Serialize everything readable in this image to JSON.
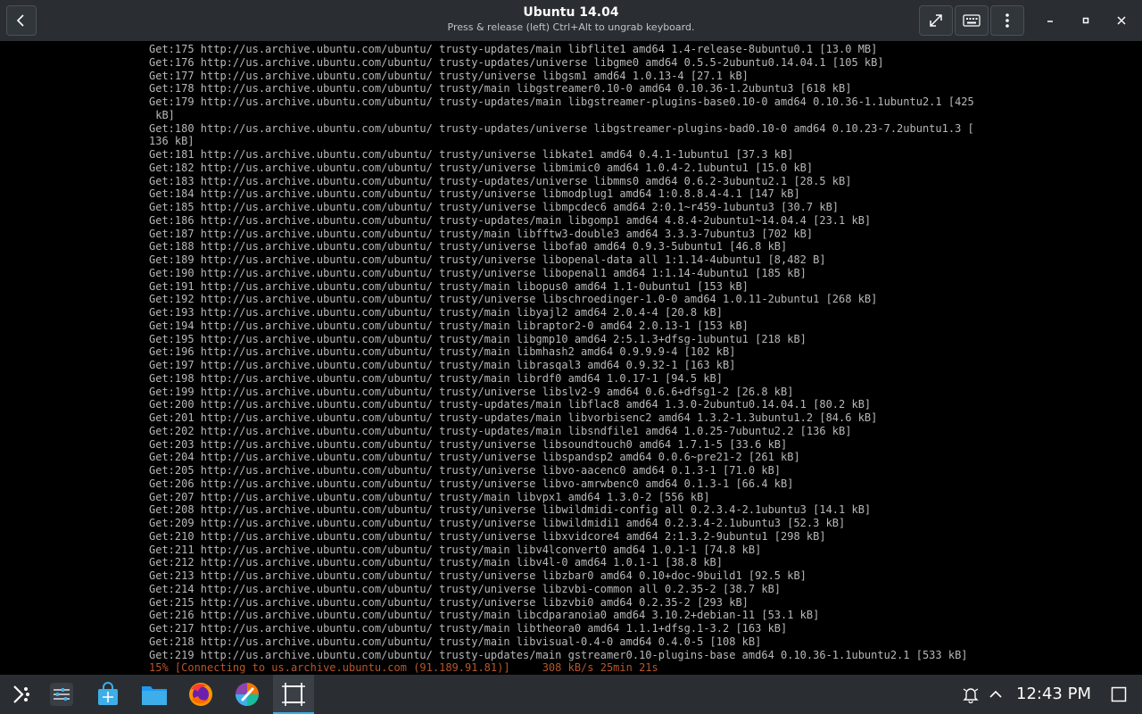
{
  "header": {
    "title": "Ubuntu 14.04",
    "subtitle": "Press & release (left) Ctrl+Alt to ungrab keyboard."
  },
  "icons": {
    "back": "chevron-left-icon",
    "fullscreen": "expand-arrows-icon",
    "keyboard": "keyboard-icon",
    "menu": "kebab-menu-icon",
    "minimize": "minimize-icon",
    "maximize": "maximize-icon",
    "close": "close-icon"
  },
  "terminal": {
    "lines": [
      "Get:175 http://us.archive.ubuntu.com/ubuntu/ trusty-updates/main libflite1 amd64 1.4-release-8ubuntu0.1 [13.0 MB]",
      "Get:176 http://us.archive.ubuntu.com/ubuntu/ trusty-updates/universe libgme0 amd64 0.5.5-2ubuntu0.14.04.1 [105 kB]",
      "Get:177 http://us.archive.ubuntu.com/ubuntu/ trusty/universe libgsm1 amd64 1.0.13-4 [27.1 kB]",
      "Get:178 http://us.archive.ubuntu.com/ubuntu/ trusty/main libgstreamer0.10-0 amd64 0.10.36-1.2ubuntu3 [618 kB]",
      "Get:179 http://us.archive.ubuntu.com/ubuntu/ trusty-updates/main libgstreamer-plugins-base0.10-0 amd64 0.10.36-1.1ubuntu2.1 [425",
      " kB]",
      "Get:180 http://us.archive.ubuntu.com/ubuntu/ trusty-updates/universe libgstreamer-plugins-bad0.10-0 amd64 0.10.23-7.2ubuntu1.3 [",
      "136 kB]",
      "Get:181 http://us.archive.ubuntu.com/ubuntu/ trusty/universe libkate1 amd64 0.4.1-1ubuntu1 [37.3 kB]",
      "Get:182 http://us.archive.ubuntu.com/ubuntu/ trusty/universe libmimic0 amd64 1.0.4-2.1ubuntu1 [15.0 kB]",
      "Get:183 http://us.archive.ubuntu.com/ubuntu/ trusty-updates/universe libmms0 amd64 0.6.2-3ubuntu2.1 [28.5 kB]",
      "Get:184 http://us.archive.ubuntu.com/ubuntu/ trusty/universe libmodplug1 amd64 1:0.8.8.4-4.1 [147 kB]",
      "Get:185 http://us.archive.ubuntu.com/ubuntu/ trusty/universe libmpcdec6 amd64 2:0.1~r459-1ubuntu3 [30.7 kB]",
      "Get:186 http://us.archive.ubuntu.com/ubuntu/ trusty-updates/main libgomp1 amd64 4.8.4-2ubuntu1~14.04.4 [23.1 kB]",
      "Get:187 http://us.archive.ubuntu.com/ubuntu/ trusty/main libfftw3-double3 amd64 3.3.3-7ubuntu3 [702 kB]",
      "Get:188 http://us.archive.ubuntu.com/ubuntu/ trusty/universe libofa0 amd64 0.9.3-5ubuntu1 [46.8 kB]",
      "Get:189 http://us.archive.ubuntu.com/ubuntu/ trusty/universe libopenal-data all 1:1.14-4ubuntu1 [8,482 B]",
      "Get:190 http://us.archive.ubuntu.com/ubuntu/ trusty/universe libopenal1 amd64 1:1.14-4ubuntu1 [185 kB]",
      "Get:191 http://us.archive.ubuntu.com/ubuntu/ trusty/main libopus0 amd64 1.1-0ubuntu1 [153 kB]",
      "Get:192 http://us.archive.ubuntu.com/ubuntu/ trusty/universe libschroedinger-1.0-0 amd64 1.0.11-2ubuntu1 [268 kB]",
      "Get:193 http://us.archive.ubuntu.com/ubuntu/ trusty/main libyajl2 amd64 2.0.4-4 [20.8 kB]",
      "Get:194 http://us.archive.ubuntu.com/ubuntu/ trusty/main libraptor2-0 amd64 2.0.13-1 [153 kB]",
      "Get:195 http://us.archive.ubuntu.com/ubuntu/ trusty/main libgmp10 amd64 2:5.1.3+dfsg-1ubuntu1 [218 kB]",
      "Get:196 http://us.archive.ubuntu.com/ubuntu/ trusty/main libmhash2 amd64 0.9.9.9-4 [102 kB]",
      "Get:197 http://us.archive.ubuntu.com/ubuntu/ trusty/main librasqal3 amd64 0.9.32-1 [163 kB]",
      "Get:198 http://us.archive.ubuntu.com/ubuntu/ trusty/main librdf0 amd64 1.0.17-1 [94.5 kB]",
      "Get:199 http://us.archive.ubuntu.com/ubuntu/ trusty/universe libslv2-9 amd64 0.6.6+dfsg1-2 [26.8 kB]",
      "Get:200 http://us.archive.ubuntu.com/ubuntu/ trusty-updates/main libflac8 amd64 1.3.0-2ubuntu0.14.04.1 [80.2 kB]",
      "Get:201 http://us.archive.ubuntu.com/ubuntu/ trusty-updates/main libvorbisenc2 amd64 1.3.2-1.3ubuntu1.2 [84.6 kB]",
      "Get:202 http://us.archive.ubuntu.com/ubuntu/ trusty-updates/main libsndfile1 amd64 1.0.25-7ubuntu2.2 [136 kB]",
      "Get:203 http://us.archive.ubuntu.com/ubuntu/ trusty/universe libsoundtouch0 amd64 1.7.1-5 [33.6 kB]",
      "Get:204 http://us.archive.ubuntu.com/ubuntu/ trusty/universe libspandsp2 amd64 0.0.6~pre21-2 [261 kB]",
      "Get:205 http://us.archive.ubuntu.com/ubuntu/ trusty/universe libvo-aacenc0 amd64 0.1.3-1 [71.0 kB]",
      "Get:206 http://us.archive.ubuntu.com/ubuntu/ trusty/universe libvo-amrwbenc0 amd64 0.1.3-1 [66.4 kB]",
      "Get:207 http://us.archive.ubuntu.com/ubuntu/ trusty/main libvpx1 amd64 1.3.0-2 [556 kB]",
      "Get:208 http://us.archive.ubuntu.com/ubuntu/ trusty/universe libwildmidi-config all 0.2.3.4-2.1ubuntu3 [14.1 kB]",
      "Get:209 http://us.archive.ubuntu.com/ubuntu/ trusty/universe libwildmidi1 amd64 0.2.3.4-2.1ubuntu3 [52.3 kB]",
      "Get:210 http://us.archive.ubuntu.com/ubuntu/ trusty/universe libxvidcore4 amd64 2:1.3.2-9ubuntu1 [298 kB]",
      "Get:211 http://us.archive.ubuntu.com/ubuntu/ trusty/main libv4lconvert0 amd64 1.0.1-1 [74.8 kB]",
      "Get:212 http://us.archive.ubuntu.com/ubuntu/ trusty/main libv4l-0 amd64 1.0.1-1 [38.8 kB]",
      "Get:213 http://us.archive.ubuntu.com/ubuntu/ trusty/universe libzbar0 amd64 0.10+doc-9build1 [92.5 kB]",
      "Get:214 http://us.archive.ubuntu.com/ubuntu/ trusty/universe libzvbi-common all 0.2.35-2 [38.7 kB]",
      "Get:215 http://us.archive.ubuntu.com/ubuntu/ trusty/universe libzvbi0 amd64 0.2.35-2 [293 kB]",
      "Get:216 http://us.archive.ubuntu.com/ubuntu/ trusty/main libcdparanoia0 amd64 3.10.2+debian-11 [53.1 kB]",
      "Get:217 http://us.archive.ubuntu.com/ubuntu/ trusty/main libtheora0 amd64 1.1.1+dfsg.1-3.2 [163 kB]",
      "Get:218 http://us.archive.ubuntu.com/ubuntu/ trusty/main libvisual-0.4-0 amd64 0.4.0-5 [108 kB]",
      "Get:219 http://us.archive.ubuntu.com/ubuntu/ trusty-updates/main gstreamer0.10-plugins-base amd64 0.10.36-1.1ubuntu2.1 [533 kB]"
    ],
    "progress_line": "15% [Connecting to us.archive.ubuntu.com (91.189.91.81)]     308 kB/s 25min 21s"
  },
  "taskbar": {
    "apps": [
      {
        "name": "launcher-icon"
      },
      {
        "name": "system-settings-icon"
      },
      {
        "name": "discover-store-icon"
      },
      {
        "name": "file-manager-icon"
      },
      {
        "name": "firefox-icon"
      },
      {
        "name": "color-picker-app-icon"
      },
      {
        "name": "virtual-machine-manager-icon"
      }
    ],
    "clock": "12:43 PM",
    "tray_icons": [
      "notification-bell-icon",
      "tray-expand-icon",
      "show-desktop-icon"
    ]
  }
}
